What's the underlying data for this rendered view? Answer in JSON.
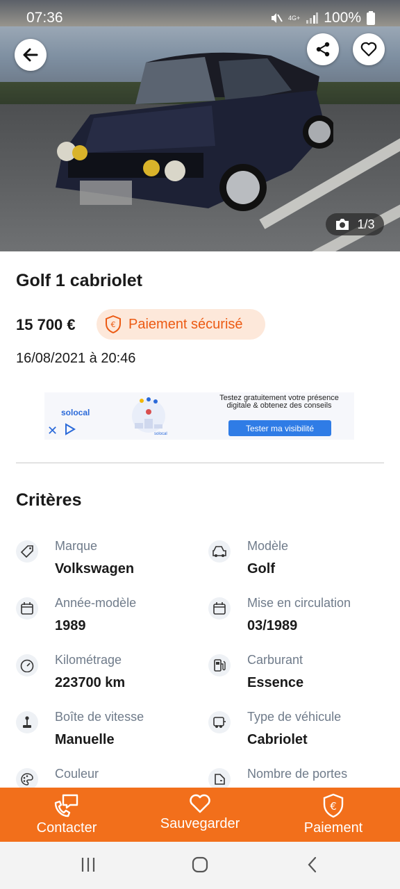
{
  "status_bar": {
    "time": "07:36",
    "battery": "100%",
    "network": "4G+"
  },
  "hero": {
    "photo_counter": "1/3",
    "icons": [
      "back-arrow-icon",
      "share-icon",
      "heart-icon",
      "camera-icon"
    ]
  },
  "listing": {
    "title": "Golf 1 cabriolet",
    "price": "15 700 €",
    "secure_payment": "Paiement sécurisé",
    "date": "16/08/2021 à 20:46"
  },
  "ad": {
    "brand": "solocal",
    "text": "Testez gratuitement votre présence digitale & obtenez des conseils",
    "cta": "Tester ma visibilité",
    "illustration_label": "solocal"
  },
  "criteria": {
    "title": "Critères",
    "items": [
      {
        "label": "Marque",
        "value": "Volkswagen",
        "icon": "tag-icon"
      },
      {
        "label": "Modèle",
        "value": "Golf",
        "icon": "car-icon"
      },
      {
        "label": "Année-modèle",
        "value": "1989",
        "icon": "calendar-icon"
      },
      {
        "label": "Mise en circulation",
        "value": "03/1989",
        "icon": "calendar-icon"
      },
      {
        "label": "Kilométrage",
        "value": "223700 km",
        "icon": "speedometer-icon"
      },
      {
        "label": "Carburant",
        "value": "Essence",
        "icon": "fuel-pump-icon"
      },
      {
        "label": "Boîte de vitesse",
        "value": "Manuelle",
        "icon": "gear-stick-icon"
      },
      {
        "label": "Type de véhicule",
        "value": "Cabriolet",
        "icon": "vehicle-type-icon"
      },
      {
        "label": "Couleur",
        "value": "",
        "icon": "palette-icon"
      },
      {
        "label": "Nombre de portes",
        "value": "",
        "icon": "door-icon"
      }
    ]
  },
  "actions": {
    "contact": "Contacter",
    "save": "Sauvegarder",
    "pay": "Paiement"
  },
  "colors": {
    "accent": "#f26f1b",
    "secure_badge_bg": "#fde8da",
    "secure_text": "#ec5a13",
    "label_gray": "#6f7b8a"
  }
}
